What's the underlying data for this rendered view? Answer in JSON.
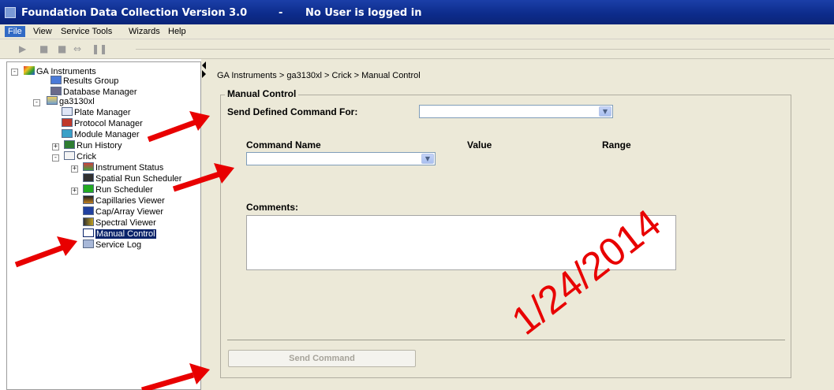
{
  "window": {
    "title": "Foundation Data Collection Version 3.0",
    "separator": "-",
    "user_status": "No User is logged in"
  },
  "menu": [
    "File",
    "View",
    "Service Tools",
    "Wizards",
    "Help"
  ],
  "toolbar": {
    "buttons": [
      "play-icon",
      "stop-icon",
      "stop-icon",
      "skip-icon",
      "pause-icon"
    ]
  },
  "tree": {
    "root": "GA Instruments",
    "items": [
      "Results Group",
      "Database Manager",
      "ga3130xl",
      "Plate Manager",
      "Protocol Manager",
      "Module Manager",
      "Run History",
      "Crick",
      "Instrument Status",
      "Spatial Run Scheduler",
      "Run Scheduler",
      "Capillaries Viewer",
      "Cap/Array Viewer",
      "Spectral Viewer",
      "Manual Control",
      "Service Log"
    ],
    "selected": "Manual Control"
  },
  "content": {
    "breadcrumb": "GA Instruments > ga3130xl > Crick > Manual Control",
    "group_title": "Manual Control",
    "send_defined_label": "Send Defined Command For:",
    "send_defined_value": "",
    "col_command": "Command Name",
    "col_value": "Value",
    "col_range": "Range",
    "command_value": "",
    "comments_label": "Comments:",
    "comments_value": "",
    "send_button": "Send Command"
  },
  "annotation": {
    "stamp_text": "1/24/2014",
    "color": "#e80000"
  }
}
